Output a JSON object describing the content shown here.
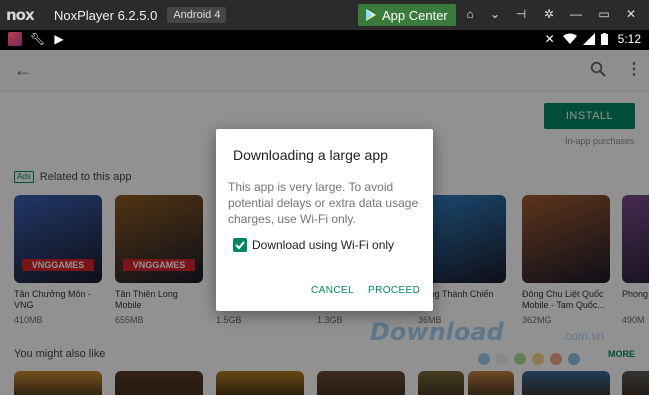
{
  "titlebar": {
    "logo_text": "nox",
    "app_title": "NoxPlayer 6.2.5.0",
    "android_badge": "Android 4",
    "app_center_label": "App Center",
    "icons": [
      "home-icon",
      "chevron-down-icon",
      "pin-icon",
      "settings-icon",
      "minimize-icon",
      "close-icon"
    ]
  },
  "statusbar": {
    "left_icons": [
      "app-avatar-icon",
      "wrench-icon",
      "play-store-icon"
    ],
    "right_icons": [
      "mute-icon",
      "wifi-icon",
      "signal-icon",
      "battery-icon"
    ],
    "time": "5:12"
  },
  "store": {
    "install_label": "INSTALL",
    "inapp_label": "In-app purchases",
    "ads_badge": "Ads",
    "related_title": "Related to this app",
    "apps": [
      {
        "name": "Tân Chưởng Môn - VNG",
        "size": "410MB",
        "logo": "VNGGAMES",
        "color": "#3a5fb0"
      },
      {
        "name": "Tân Thiên Long Mobile",
        "size": "655MB",
        "logo": "VNGGAMES",
        "color": "#8a5a20"
      },
      {
        "name": "",
        "size": "1.5GB",
        "logo": "",
        "color": "#5a6a3a"
      },
      {
        "name": "",
        "size": "1.3GB",
        "logo": "",
        "color": "#4a4a6a"
      },
      {
        "name": "Công Thành Chiến",
        "size": "36MB",
        "logo": "",
        "color": "#2f7fc0"
      },
      {
        "name": "Đông Chu Liệt Quốc Mobile - Tam Quốc...",
        "size": "362MG",
        "logo": "",
        "color": "#a05a30"
      },
      {
        "name": "Phong",
        "size": "490M",
        "logo": "",
        "color": "#7a4a8a"
      }
    ],
    "also_like_title": "You might also like",
    "more_label": "MORE",
    "bottom_colors": [
      "#c88a30",
      "#5a3a2a",
      "#b07a20",
      "#6a4a3a",
      "#7a6a3a",
      "#c08040",
      "#3a6a9a",
      "#5a5a5a"
    ]
  },
  "dialog": {
    "title": "Downloading a large app",
    "body": "This app is very large. To avoid potential delays or extra data usage charges, use Wi-Fi only.",
    "checkbox_label": "Download using Wi-Fi only",
    "checkbox_checked": true,
    "cancel_label": "CANCEL",
    "proceed_label": "PROCEED"
  },
  "watermark": {
    "text": "Download",
    "suffix": ".com.vn",
    "dot_colors": [
      "#7ab8e8",
      "#e8e8e8",
      "#9ad070",
      "#f0c060",
      "#e88a60",
      "#6aa8d8"
    ]
  }
}
